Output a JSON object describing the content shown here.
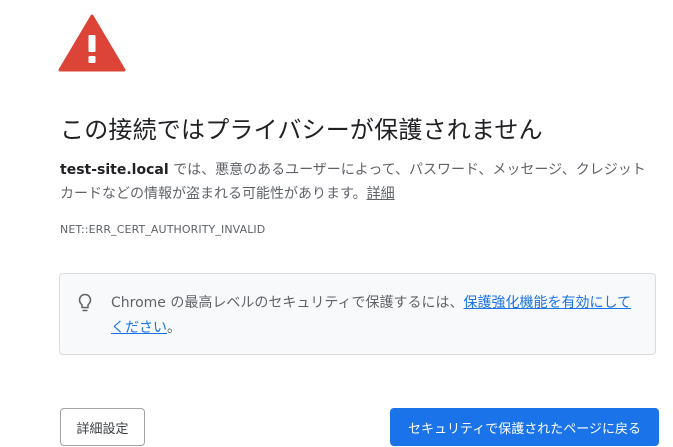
{
  "warning_icon": "warning-triangle-icon",
  "heading": "この接続ではプライバシーが保護されません",
  "explanation": {
    "host": "test-site.local",
    "text": " では、悪意のあるユーザーによって、パスワード、メッセージ、クレジット カードなどの情報が盗まれる可能性があります。",
    "details_link": "詳細"
  },
  "error_code": "NET::ERR_CERT_AUTHORITY_INVALID",
  "enhanced_protection": {
    "icon": "lightbulb-icon",
    "text_before": "Chrome の最高レベルのセキュリティで保護するには、",
    "link": "保護強化機能を有効にしてください",
    "text_after": "。"
  },
  "buttons": {
    "advanced": "詳細設定",
    "back_to_safety": "セキュリティで保護されたページに戻る"
  },
  "colors": {
    "warning_red": "#db4437",
    "primary_blue": "#1a73e8",
    "text_gray": "#5f6368"
  }
}
